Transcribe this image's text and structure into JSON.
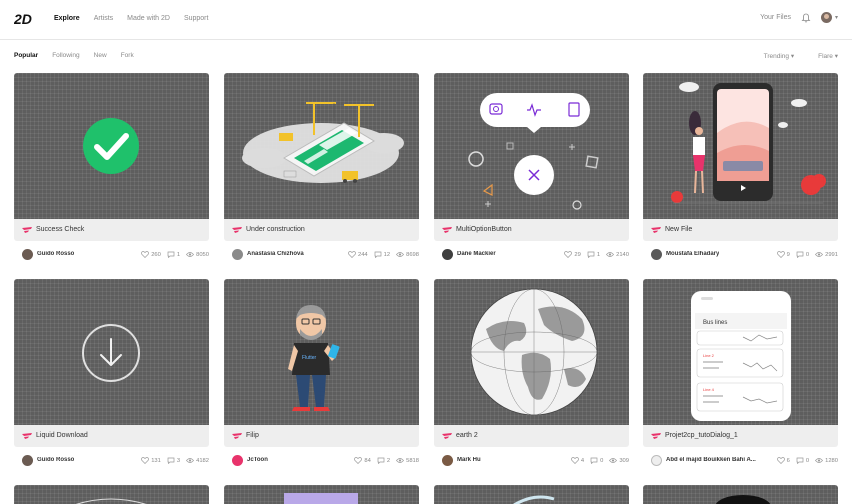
{
  "header": {
    "logo": "2D",
    "nav": [
      "Explore",
      "Artists",
      "Made with 2D",
      "Support"
    ],
    "your_files": "Your Files"
  },
  "filters": [
    "Popular",
    "Following",
    "New",
    "Fork"
  ],
  "sorts": [
    "Trending",
    "Flare"
  ],
  "colors": {
    "thumb_bg": "#5e5e5e",
    "flare_pink": "#e8336b",
    "check_green": "#1fc16b",
    "accent_purple": "#7a2bd6"
  },
  "cards": [
    {
      "title": "Success Check",
      "author": "Guido Rosso",
      "likes": "260",
      "comments": "1",
      "views": "8050"
    },
    {
      "title": "Under construction",
      "author": "Anastasia Chizhova",
      "likes": "244",
      "comments": "12",
      "views": "8698"
    },
    {
      "title": "MultiOptionButton",
      "author": "Dane Mackier",
      "likes": "29",
      "comments": "1",
      "views": "2140"
    },
    {
      "title": "New File",
      "author": "Moustafa Elhadary",
      "likes": "9",
      "comments": "0",
      "views": "2991"
    },
    {
      "title": "Liquid Download",
      "author": "Guido Rosso",
      "likes": "131",
      "comments": "3",
      "views": "4182"
    },
    {
      "title": "Filip",
      "author": "JcToon",
      "likes": "84",
      "comments": "2",
      "views": "5818"
    },
    {
      "title": "earth 2",
      "author": "Mark Hu",
      "likes": "4",
      "comments": "0",
      "views": "309"
    },
    {
      "title": "Projet2cp_tutoDialog_1",
      "author": "Abd el majid Bouikken Bahi A...",
      "likes": "6",
      "comments": "0",
      "views": "1280"
    }
  ],
  "thumb_text": {
    "bus_title": "Bus lines",
    "line2": "Line 2",
    "line4": "Line 4"
  }
}
